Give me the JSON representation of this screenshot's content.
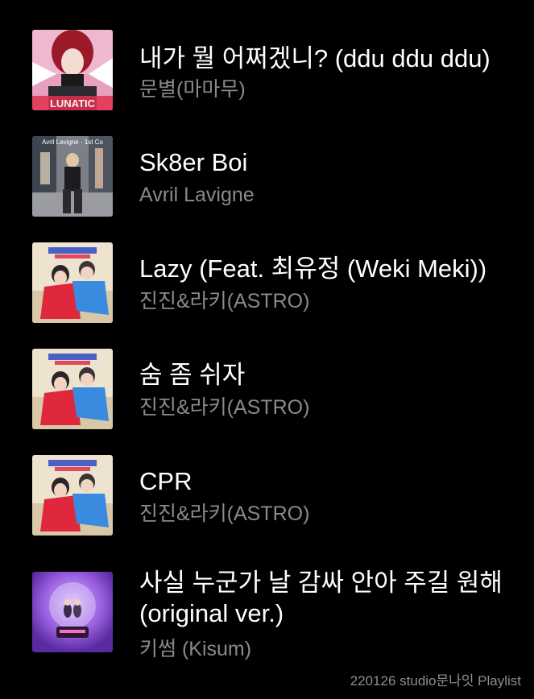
{
  "tracks": [
    {
      "title": "내가 뭘 어쩌겠니? (ddu ddu ddu)",
      "artist": "문별(마마무)",
      "cover": "lunatic-cover"
    },
    {
      "title": "Sk8er Boi",
      "artist": "Avril Lavigne",
      "cover": "avril-street-cover"
    },
    {
      "title": "Lazy (Feat. 최유정 (Weki Meki))",
      "artist": "진진&라키(ASTRO)",
      "cover": "jinjin-rocky-cover"
    },
    {
      "title": "숨 좀 쉬자",
      "artist": "진진&라키(ASTRO)",
      "cover": "jinjin-rocky-cover"
    },
    {
      "title": "CPR",
      "artist": "진진&라키(ASTRO)",
      "cover": "jinjin-rocky-cover"
    },
    {
      "title": "사실 누군가 날 감싸 안아 주길 원해 (original ver.)",
      "artist": "키썸 (Kisum)",
      "cover": "snow-globe-cover"
    }
  ],
  "cover_texts": {
    "lunatic": "LUNATIC",
    "avril": "Avril Lavigne · 1st Co"
  },
  "footer": "220126 studio문나잇 Playlist"
}
